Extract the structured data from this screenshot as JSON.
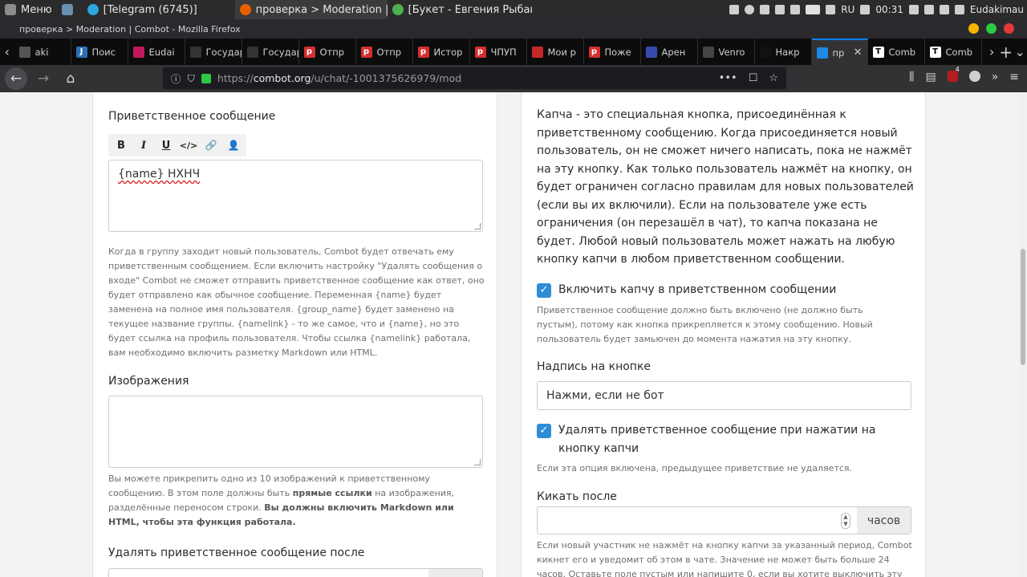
{
  "system": {
    "menu": "Меню",
    "tasks": [
      "[Telegram (6745)]",
      "проверка > Moderation | ...",
      "[Букет - Евгения Рыбако..."
    ],
    "lang": "RU",
    "time": "00:31",
    "user": "Eudakimau"
  },
  "window": {
    "title": "проверка > Moderation | Combot - Mozilla Firefox"
  },
  "tabs": [
    {
      "label": "aki",
      "fav": "",
      "color": "#555"
    },
    {
      "label": "Поис",
      "fav": "J",
      "color": "#2d6fb7"
    },
    {
      "label": "Eudai",
      "fav": "",
      "color": "#c2185b"
    },
    {
      "label": "Государс",
      "fav": "",
      "color": "#333"
    },
    {
      "label": "Государс",
      "fav": "",
      "color": "#333"
    },
    {
      "label": "Отпр",
      "fav": "p",
      "color": "#d32f2f"
    },
    {
      "label": "Отпр",
      "fav": "p",
      "color": "#d32f2f"
    },
    {
      "label": "Истор",
      "fav": "p",
      "color": "#d32f2f"
    },
    {
      "label": "ЧПУП",
      "fav": "p",
      "color": "#d32f2f"
    },
    {
      "label": "Мои р",
      "fav": "",
      "color": "#c62828"
    },
    {
      "label": "Поже",
      "fav": "p",
      "color": "#d32f2f"
    },
    {
      "label": "Арен",
      "fav": "",
      "color": "#3949ab"
    },
    {
      "label": "Venro",
      "fav": "",
      "color": "#444"
    },
    {
      "label": "Накр",
      "fav": "",
      "color": "#111"
    },
    {
      "label": "пр",
      "fav": "",
      "color": "#1e88e5",
      "active": true
    },
    {
      "label": "Comb",
      "fav": "T",
      "color": "#fff"
    },
    {
      "label": "Comb",
      "fav": "T",
      "color": "#fff"
    }
  ],
  "nav": {
    "url_prefix": "https://",
    "url_host": "combot.org",
    "url_path": "/u/chat/-1001375626979/mod",
    "badge": "4"
  },
  "left": {
    "welcome_label": "Приветственное сообщение",
    "toolbar": [
      "B",
      "I",
      "U",
      "</>",
      "🔗",
      "👤"
    ],
    "welcome_value": "{name} НХНЧ",
    "welcome_help": "Когда в группу заходит новый пользователь, Combot будет отвечать ему приветственным сообщением. Если включить настройку \"Удалять сообщения о входе\" Combot не сможет отправить приветственное сообщение как ответ, оно будет отправлено как обычное сообщение. Переменная {name} будет заменена на полное имя пользователя. {group_name} будет заменено на текущее название группы. {namelink} - то же самое, что и {name}, но это будет ссылка на профиль пользователя. Чтобы ссылка {namelink} работала, вам необходимо включить разметку Markdown или HTML.",
    "images_label": "Изображения",
    "images_help_1": "Вы можете прикрепить одно из 10 изображений к приветственному сообщению. В этом поле должны быть ",
    "images_help_bold1": "прямые ссылки",
    "images_help_2": " на изображения, разделённые переносом строки. ",
    "images_help_bold2": "Вы должны включить Markdown или HTML, чтобы эта функция работала.",
    "delete_after_label": "Удалять приветственное сообщение после"
  },
  "right": {
    "captcha_desc": "Капча - это специальная кнопка, присоединённая к приветственному сообщению. Когда присоединяется новый пользователь, он не сможет ничего написать, пока не нажмёт на эту кнопку. Как только пользователь нажмёт на кнопку, он будет ограничен согласно правилам для новых пользователей (если вы их включили). Если на пользователе уже есть ограничения (он перезашёл в чат), то капча показана не будет. Любой новый пользователь может нажать на любую кнопку капчи в любом приветственном сообщении.",
    "enable_captcha_label": "Включить капчу в приветственном сообщении",
    "enable_captcha_help": "Приветственное сообщение должно быть включено (не должно быть пустым), потому как кнопка прикрепляется к этому сообщению. Новый пользователь будет замьючен до момента нажатия на эту кнопку.",
    "button_text_label": "Надпись на кнопке",
    "button_text_value": "Нажми, если не бот",
    "delete_on_click_label": "Удалять приветственное сообщение при нажатии на кнопку капчи",
    "delete_on_click_help": "Если эта опция включена, предыдущее приветствие не удаляется.",
    "kick_label": "Кикать после",
    "kick_unit": "часов",
    "kick_help": "Если новый участник не нажмёт на кнопку капчи за указанный период, Combot кикнет его и уведомит об этом в чате. Значение не может быть больше 24 часов. Оставьте поле пустым или напишите 0, если вы хотите выключить эту опцию."
  }
}
